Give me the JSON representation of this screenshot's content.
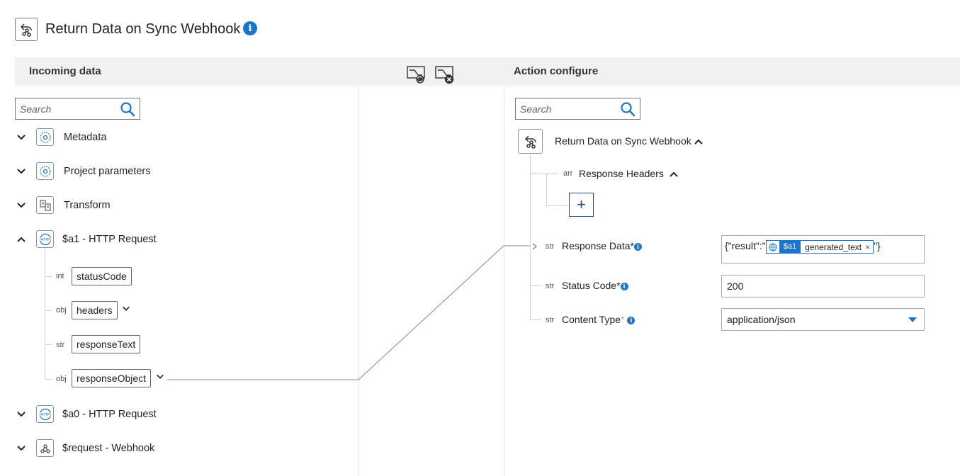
{
  "header": {
    "title": "Return Data on Sync Webhook",
    "info_icon": "info-icon"
  },
  "left": {
    "title": "Incoming data",
    "search_placeholder": "Search",
    "nodes": [
      {
        "label": "Metadata",
        "icon": "gear-icon",
        "expanded": false
      },
      {
        "label": "Project parameters",
        "icon": "gear-icon",
        "expanded": false
      },
      {
        "label": "Transform",
        "icon": "transform-icon",
        "expanded": false
      },
      {
        "label": "$a1 - HTTP Request",
        "icon": "http-icon",
        "expanded": true
      },
      {
        "label": "$a0 - HTTP Request",
        "icon": "http-icon",
        "expanded": false
      },
      {
        "label": "$request - Webhook",
        "icon": "webhook-icon",
        "expanded": false
      }
    ],
    "fields": [
      {
        "type": "int",
        "name": "statusCode"
      },
      {
        "type": "obj",
        "name": "headers"
      },
      {
        "type": "str",
        "name": "responseText"
      },
      {
        "type": "obj",
        "name": "responseObject"
      }
    ]
  },
  "toolbar": {
    "hide_icon": "hide-unmapped-icon",
    "clear_icon": "clear-mapping-icon"
  },
  "right": {
    "title": "Action configure",
    "search_placeholder": "Search",
    "root_label": "Return Data on Sync Webhook",
    "headers": {
      "type": "arr",
      "label": "Response Headers",
      "add_label": "+"
    },
    "rows": [
      {
        "type": "str",
        "label": "Response Data",
        "required": "*"
      },
      {
        "type": "str",
        "label": "Status Code",
        "required": "*",
        "value": "200"
      },
      {
        "type": "str",
        "label": "Content Type",
        "required": "*",
        "value": "application/json"
      }
    ],
    "response_data": {
      "prefix": "{\"result\":\"",
      "chip_tag": "$a1",
      "chip_value": "generated_text",
      "chip_remove": "×",
      "suffix": "\"}"
    }
  },
  "colors": {
    "accent": "#1d74c9",
    "band": "#f1f1f1",
    "connector": "#888888"
  }
}
